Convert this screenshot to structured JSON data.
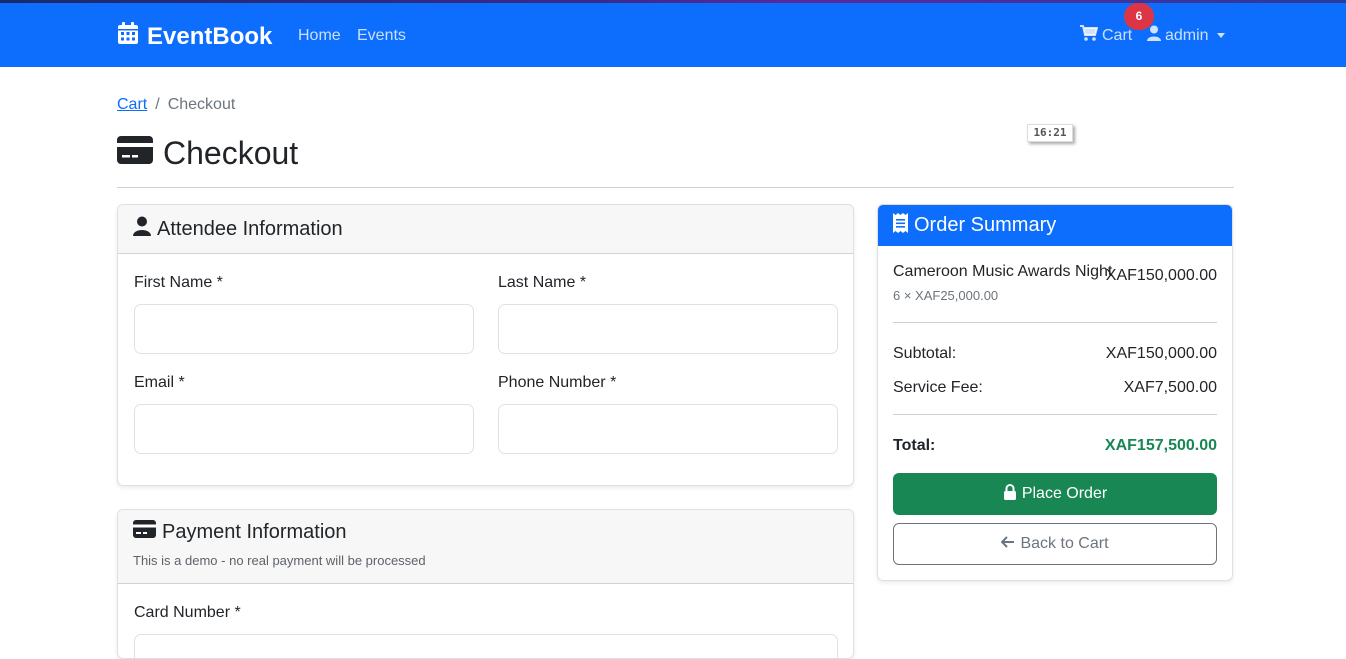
{
  "nav": {
    "brand": "EventBook",
    "links": [
      "Home",
      "Events"
    ],
    "cart_label": "Cart",
    "cart_count": "6",
    "user": "admin"
  },
  "breadcrumb": {
    "parent": "Cart",
    "separator": "/",
    "current": "Checkout"
  },
  "page_title": "Checkout",
  "time_chip": "16:21",
  "attendee": {
    "title": "Attendee Information",
    "first_name_label": "First Name *",
    "last_name_label": "Last Name *",
    "email_label": "Email *",
    "phone_label": "Phone Number *"
  },
  "payment": {
    "title": "Payment Information",
    "note": "This is a demo - no real payment will be processed",
    "card_number_label": "Card Number *"
  },
  "summary": {
    "title": "Order Summary",
    "item_name": "Cameroon Music Awards Night",
    "item_total": "XAF150,000.00",
    "item_detail": "6 × XAF25,000.00",
    "subtotal_label": "Subtotal:",
    "subtotal_value": "XAF150,000.00",
    "fee_label": "Service Fee:",
    "fee_value": "XAF7,500.00",
    "total_label": "Total:",
    "total_value": "XAF157,500.00",
    "place_order": "Place Order",
    "back_to_cart": "Back to Cart"
  },
  "colors": {
    "primary": "#0d6efd",
    "success": "#198754",
    "danger": "#dc3545"
  }
}
